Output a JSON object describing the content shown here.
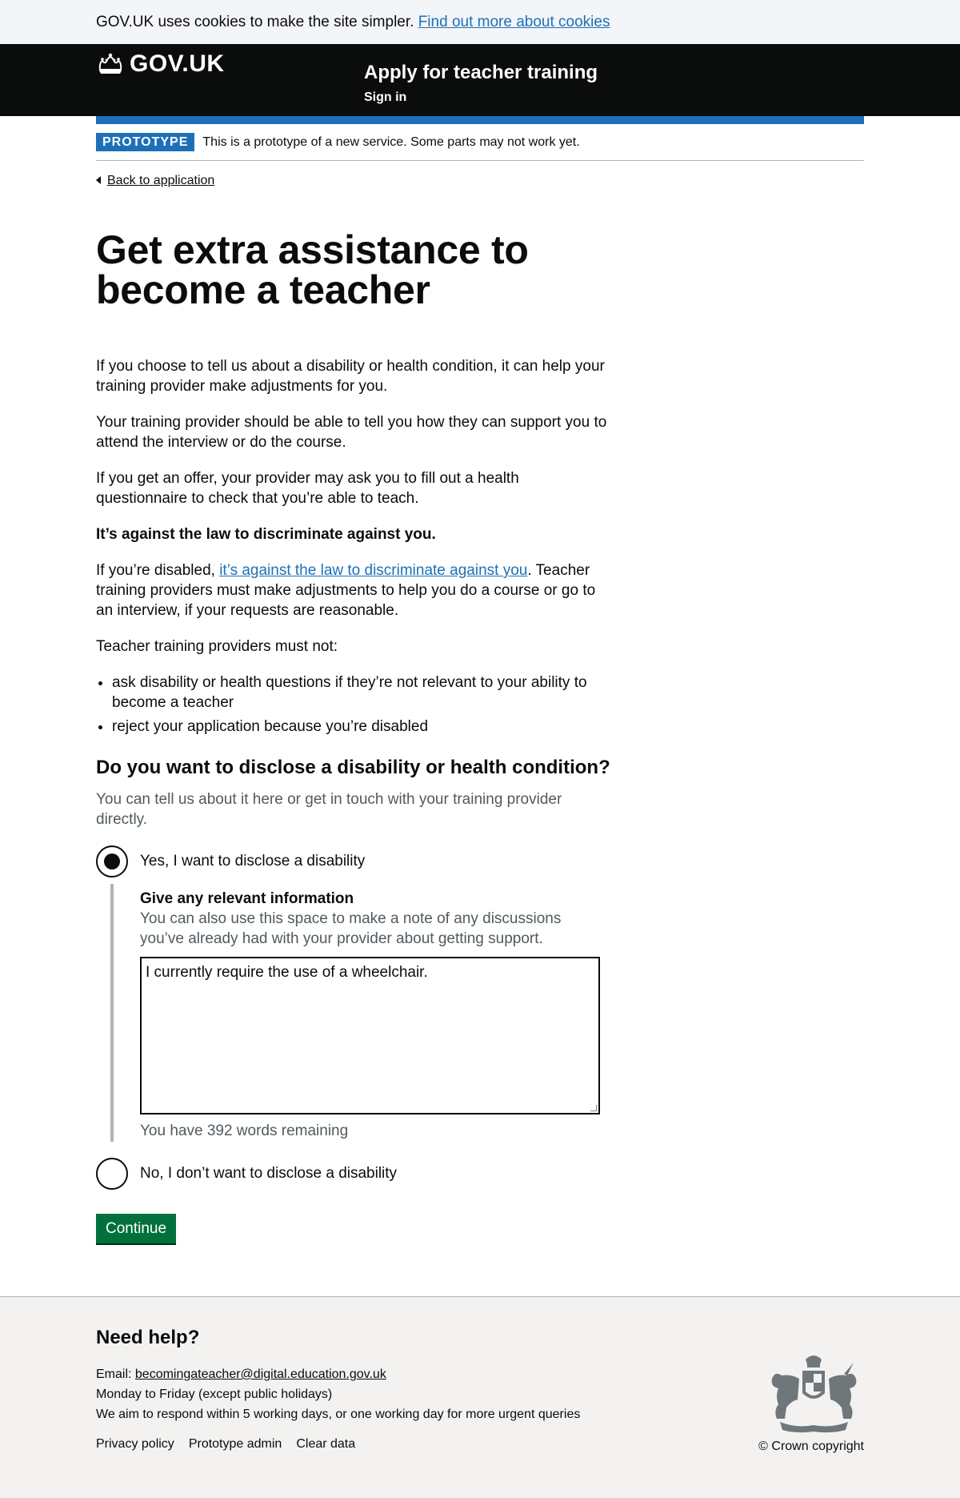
{
  "cookie_banner": {
    "text": "GOV.UK uses cookies to make the site simpler.",
    "link": "Find out more about cookies"
  },
  "header": {
    "logo_text": "GOV.UK",
    "service_name": "Apply for teacher training",
    "nav_sign_in": "Sign in"
  },
  "phase_banner": {
    "tag": "PROTOTYPE",
    "text": "This is a prototype of a new service. Some parts may not work yet."
  },
  "back_link": "Back to application",
  "page_title": "Get extra assistance to become a teacher",
  "paragraphs": {
    "p1": "If you choose to tell us about a disability or health condition, it can help your training provider make adjustments for you.",
    "p2": "Your training provider should be able to tell you how they can support you to attend the interview or do the course.",
    "p3": "If you get an offer, your provider may ask you to fill out a health questionnaire to check that you’re able to teach.",
    "p4_bold": "It’s against the law to discriminate against you.",
    "p5_before": "If you’re disabled, ",
    "p5_link": "it’s against the law to discriminate against you",
    "p5_after": ". Teacher training providers must make adjustments to help you do a course or go to an interview, if your requests are reasonable.",
    "p6": "Teacher training providers must not:"
  },
  "bullets": [
    "ask disability or health questions if they’re not relevant to your ability to become a teacher",
    "reject your application because you’re disabled"
  ],
  "question": {
    "heading": "Do you want to disclose a disability or health condition?",
    "hint": "You can tell us about it here or get in touch with your training provider directly.",
    "option_yes": "Yes, I want to disclose a disability",
    "option_no": "No, I don’t want to disclose a disability",
    "selected": "yes",
    "conditional": {
      "label": "Give any relevant information",
      "hint": "You can also use this space to make a note of any discussions you’ve already had with your provider about getting support.",
      "value": "I currently require the use of a wheelchair.",
      "word_count": "You have 392 words remaining"
    }
  },
  "continue_button": "Continue",
  "footer": {
    "heading": "Need help?",
    "email_prefix": "Email: ",
    "email": "becomingateacher@digital.education.gov.uk",
    "hours": "Monday to Friday (except public holidays)",
    "response": "We aim to respond within 5 working days, or one working day for more urgent queries",
    "links": [
      "Privacy policy",
      "Prototype admin",
      "Clear data"
    ],
    "copyright": "© Crown copyright"
  }
}
